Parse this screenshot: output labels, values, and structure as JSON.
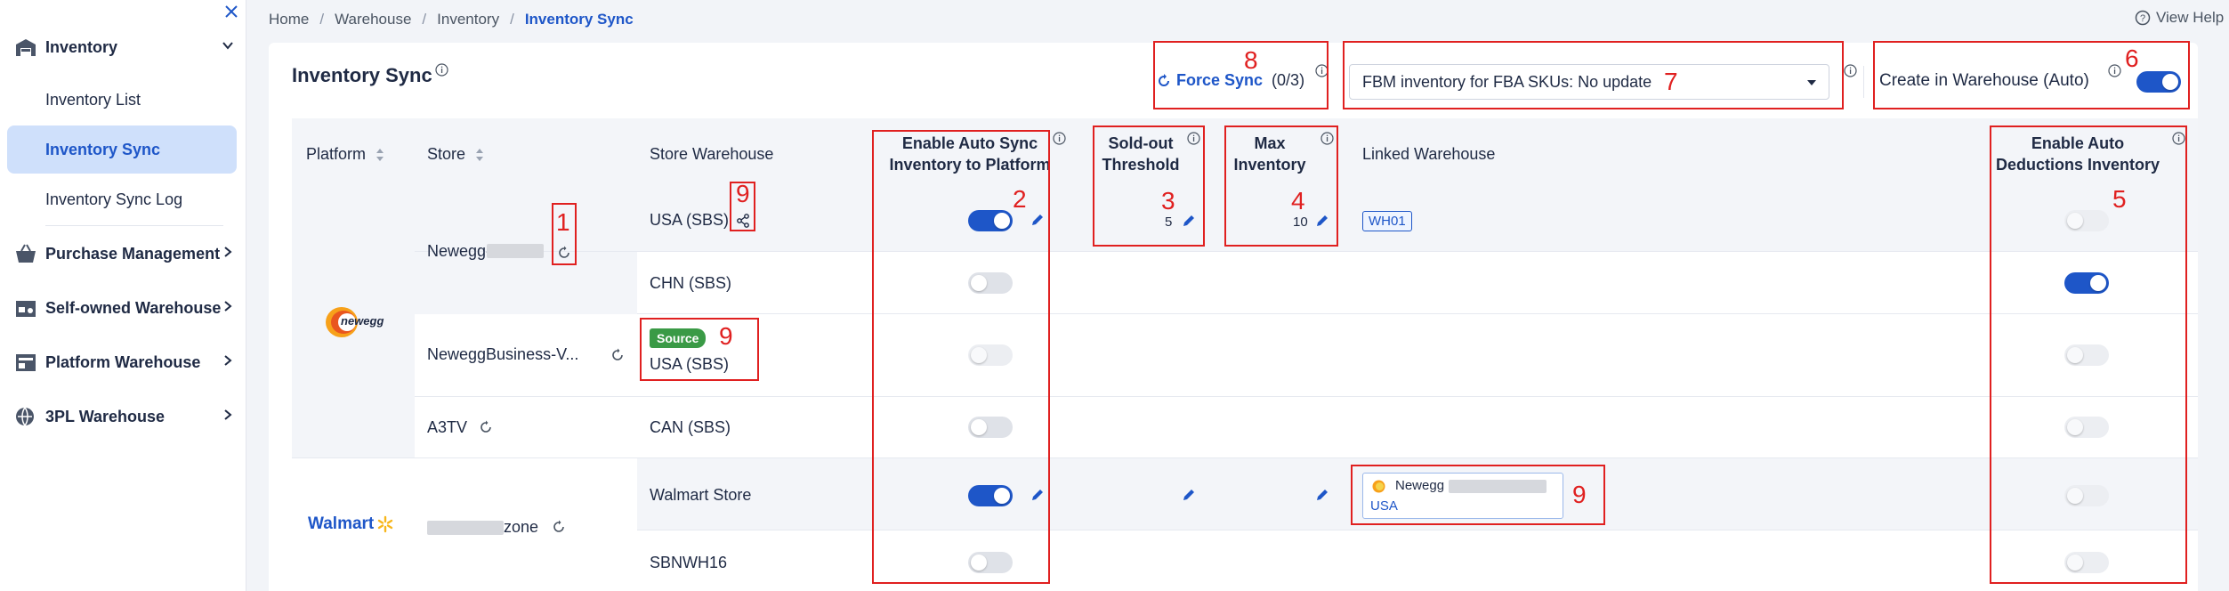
{
  "sidebar": {
    "groups": [
      {
        "label": "Inventory",
        "icon": "warehouse-icon"
      },
      {
        "label": "Purchase Management",
        "icon": "basket-icon"
      },
      {
        "label": "Self-owned Warehouse",
        "icon": "store-icon"
      },
      {
        "label": "Platform Warehouse",
        "icon": "platform-icon"
      },
      {
        "label": "3PL Warehouse",
        "icon": "globe-icon"
      }
    ],
    "subitems": [
      "Inventory List",
      "Inventory Sync",
      "Inventory Sync Log"
    ],
    "active": "Inventory Sync"
  },
  "breadcrumb": [
    "Home",
    "Warehouse",
    "Inventory",
    "Inventory Sync"
  ],
  "help": "View Help",
  "page": {
    "title": "Inventory Sync",
    "force_sync_label": "Force Sync",
    "force_sync_count": "(0/3)",
    "fbm_select": "FBM inventory for FBA SKUs: No update",
    "create_auto_label": "Create in Warehouse (Auto)",
    "create_auto_on": true
  },
  "table": {
    "headers": {
      "platform": "Platform",
      "store": "Store",
      "store_warehouse": "Store Warehouse",
      "auto_sync_1": "Enable Auto Sync",
      "auto_sync_2": "Inventory to Platform",
      "soldout_1": "Sold-out",
      "soldout_2": "Threshold",
      "max_1": "Max",
      "max_2": "Inventory",
      "linked": "Linked Warehouse",
      "deduct_1": "Enable Auto",
      "deduct_2": "Deductions Inventory"
    },
    "platforms": {
      "newegg": "newegg",
      "walmart": "Walmart"
    },
    "stores": [
      "Newegg-",
      "NeweggBusiness-V...",
      "A3TV",
      "zone"
    ],
    "rows": [
      {
        "warehouse": "USA (SBS)",
        "auto_sync": "on",
        "threshold": "5",
        "max": "10",
        "linked": "WH01",
        "deduct": "dis"
      },
      {
        "warehouse": "CHN (SBS)",
        "auto_sync": "off",
        "deduct": "on"
      },
      {
        "source_tag": "Source",
        "warehouse": "USA (SBS)",
        "auto_sync": "dis",
        "deduct": "dis"
      },
      {
        "warehouse": "CAN (SBS)",
        "auto_sync": "off",
        "deduct": "dis"
      },
      {
        "warehouse": "Walmart Store",
        "auto_sync": "on",
        "linked_store": "Newegg",
        "linked_region": "USA",
        "deduct": "dis"
      },
      {
        "warehouse": "SBNWH16",
        "auto_sync": "off",
        "deduct": "dis"
      }
    ]
  },
  "annotations": [
    "1",
    "2",
    "3",
    "4",
    "5",
    "6",
    "7",
    "8",
    "9",
    "9",
    "9"
  ],
  "colors": {
    "accent": "#1e56c8",
    "annotation": "#e02020",
    "source_tag": "#3a9a46"
  }
}
